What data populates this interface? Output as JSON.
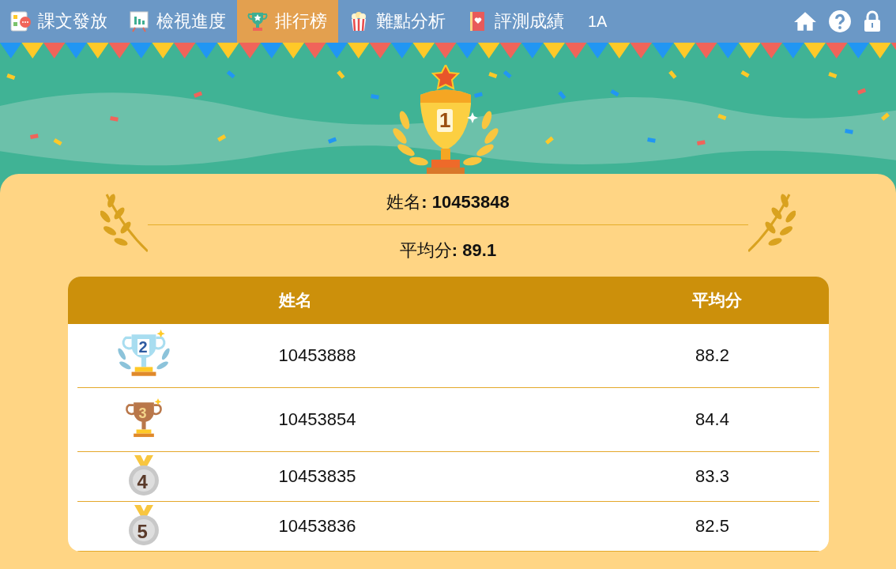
{
  "nav": {
    "tabs": [
      {
        "label": "課文發放",
        "selected": false
      },
      {
        "label": "檢視進度",
        "selected": false
      },
      {
        "label": "排行榜",
        "selected": true
      },
      {
        "label": "難點分析",
        "selected": false
      },
      {
        "label": "評測成績",
        "selected": false
      }
    ],
    "class_name": "1A"
  },
  "winner": {
    "rank": "1",
    "name_line": "姓名**: 10453848**",
    "average_line": "平均分**: 89.1**"
  },
  "table": {
    "columns": [
      "姓名",
      "平均分"
    ],
    "rows": [
      {
        "kind": "trophy-silver",
        "rank": "2",
        "name": "10453888",
        "average": "88.2"
      },
      {
        "kind": "trophy-bronze",
        "rank": "3",
        "name": "10453854",
        "average": "84.4"
      },
      {
        "kind": "medal",
        "rank": "4",
        "name": "10453835",
        "average": "83.3"
      },
      {
        "kind": "medal",
        "rank": "5",
        "name": "10453836",
        "average": "82.5"
      }
    ]
  }
}
